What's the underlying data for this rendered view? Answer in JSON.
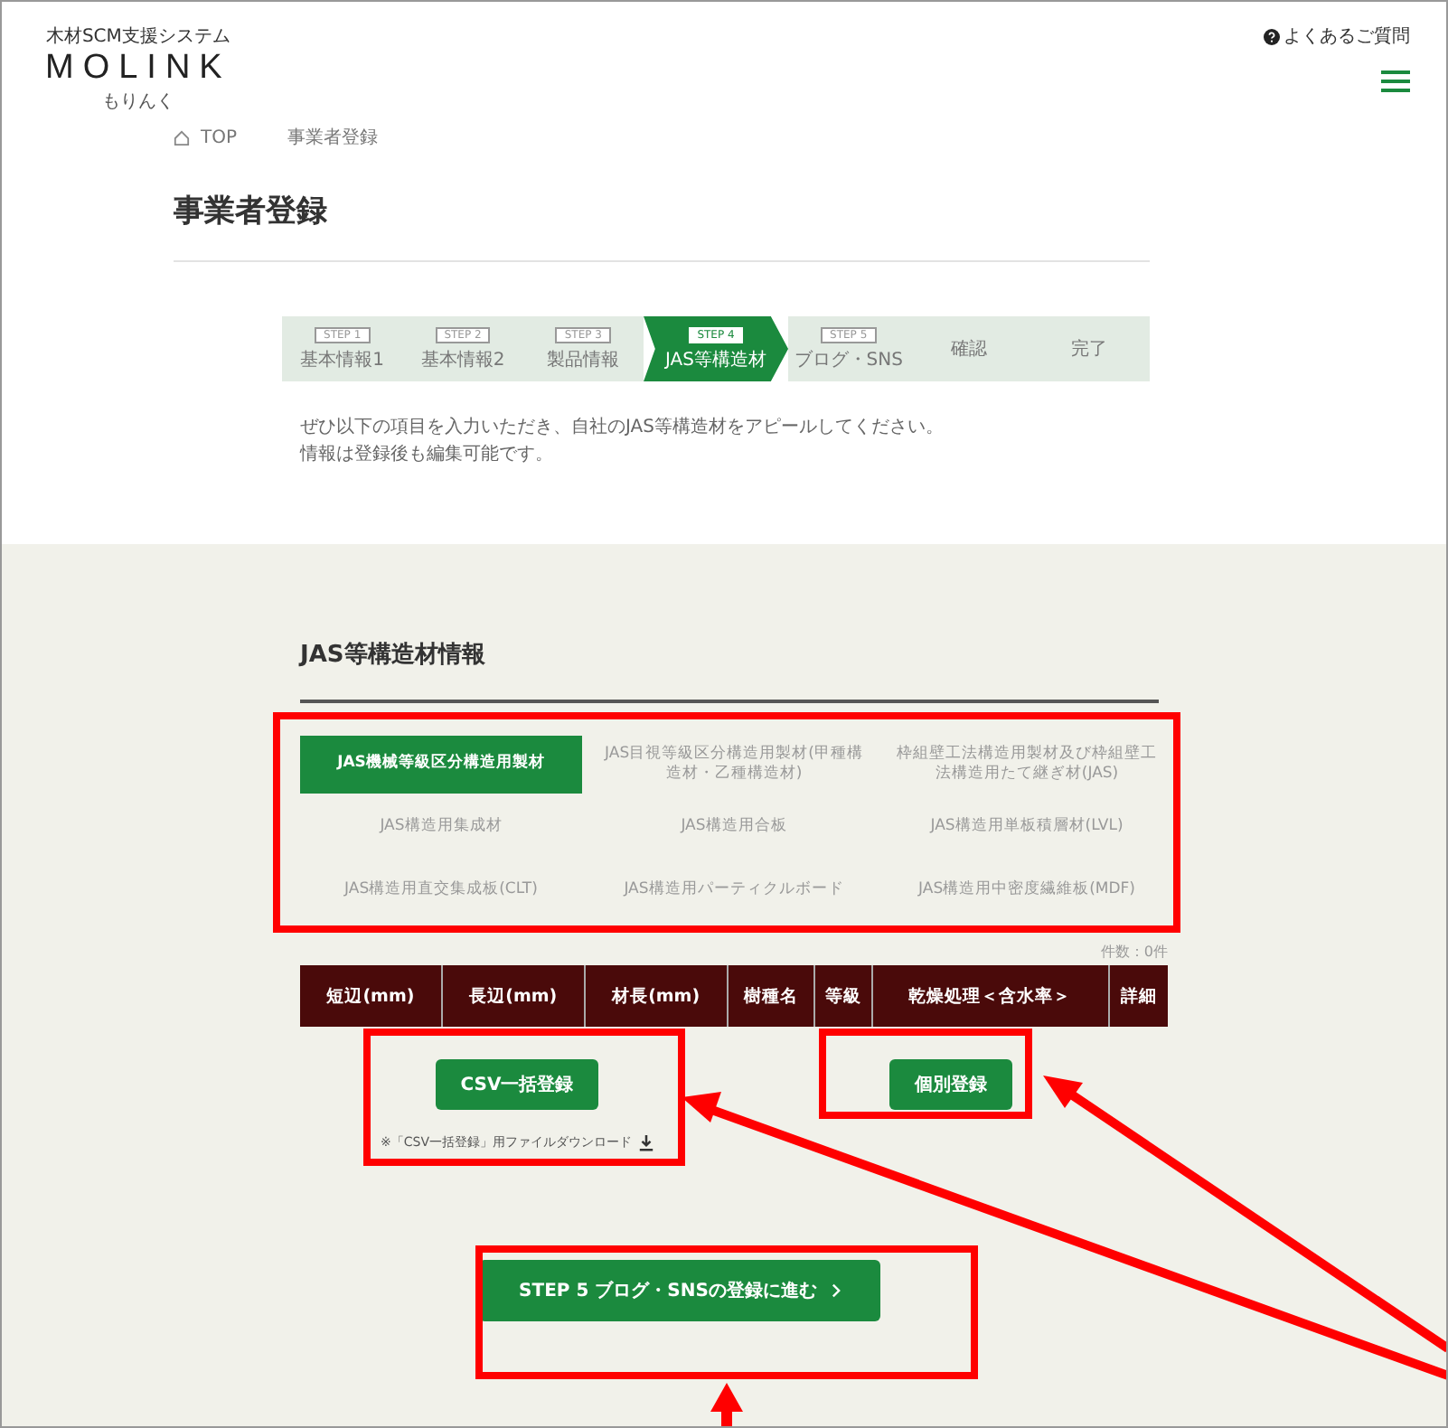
{
  "header": {
    "tagline": "木材SCM支援システム",
    "logo": "MOLINK",
    "logo_sub": "もりんく",
    "help_link": "よくあるご質問"
  },
  "breadcrumb": [
    "TOP",
    "事業者登録"
  ],
  "title": "事業者登録",
  "steps": [
    {
      "step_label": "STEP 1",
      "name": "基本情報1",
      "selected": false
    },
    {
      "step_label": "STEP 2",
      "name": "基本情報2",
      "selected": false
    },
    {
      "step_label": "STEP 3",
      "name": "製品情報",
      "selected": false
    },
    {
      "step_label": "STEP 4",
      "name": "JAS等構造材",
      "selected": true
    },
    {
      "step_label": "STEP 5",
      "name": "ブログ・SNS",
      "selected": false
    },
    {
      "name": "確認",
      "selected": false
    },
    {
      "name": "完了",
      "selected": false
    }
  ],
  "intro": [
    "ぜひ以下の項目を入力いただき、自社のJAS等構造材をアピールしてください。",
    "情報は登録後も編集可能です。"
  ],
  "section": {
    "title": "JAS等構造材情報",
    "categories": [
      {
        "label": "JAS機械等級区分構造用製材",
        "selected": true
      },
      {
        "label": "JAS目視等級区分構造用製材(甲種構造材・乙種構造材)",
        "selected": false
      },
      {
        "label": "枠組壁工法構造用製材及び枠組壁工法構造用たて継ぎ材(JAS)",
        "selected": false
      },
      {
        "label": "JAS構造用集成材",
        "selected": false
      },
      {
        "label": "JAS構造用合板",
        "selected": false
      },
      {
        "label": "JAS構造用単板積層材(LVL)",
        "selected": false
      },
      {
        "label": "JAS構造用直交集成板(CLT)",
        "selected": false
      },
      {
        "label": "JAS構造用パーティクルボード",
        "selected": false
      },
      {
        "label": "JAS構造用中密度繊維板(MDF)",
        "selected": false
      }
    ],
    "count": "件数：0件",
    "table": {
      "columns": [
        "短辺(mm)",
        "長辺(mm)",
        "材長(mm)",
        "樹種名",
        "等級",
        "乾燥処理＜含水率＞",
        "詳細"
      ]
    },
    "csv_button": "CSV一括登録",
    "individual_button": "個別登録",
    "csv_download": "※「CSV一括登録」用ファイルダウンロード"
  },
  "next_button": "STEP 5 ブログ・SNSの登録に進む"
}
